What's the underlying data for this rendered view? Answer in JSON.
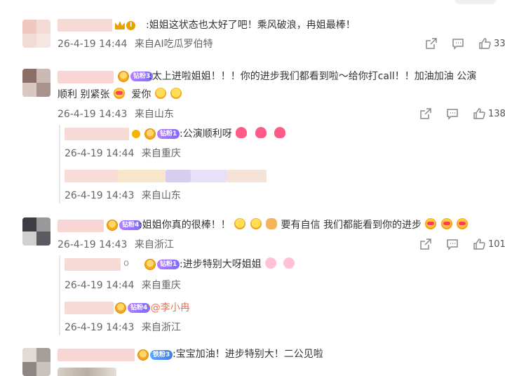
{
  "comments": [
    {
      "text": ":姐姐这状态也太好了吧！乘风破浪，冉姐最棒！",
      "date": "26-4-19 14:44",
      "source": "来自AI吃瓜罗伯特",
      "likes": "33",
      "badge": "I"
    },
    {
      "text_line1": ":太上进啦姐姐！！！你的进步我们都看到啦～给你打call！！加油加油 公演",
      "text_line2": "顺利 别紧张",
      "text_love": "爱你",
      "date": "26-4-19 14:43",
      "source": "来自山东",
      "likes": "138",
      "badge": "钻粉3",
      "replies": [
        {
          "text": ":公演顺利呀",
          "date": "26-4-19 14:44",
          "source": "来自重庆",
          "badge": "钻粉1"
        },
        {
          "text": "",
          "date": "26-4-19 14:43",
          "source": "来自山东"
        }
      ]
    },
    {
      "text_a": ":姐姐你真的很棒！！",
      "text_b": "要有自信 我们都能看到你的进步",
      "date": "26-4-19 14:43",
      "source": "来自浙江",
      "likes": "101",
      "badge": "钻粉4",
      "replies": [
        {
          "text": ":进步特别大呀姐姐",
          "date": "26-4-19 14:44",
          "source": "来自重庆",
          "badge": "钻粉1"
        },
        {
          "text": ":@李小冉",
          "date": "26-4-19 14:43",
          "source": "来自浙江",
          "badge": "钻粉4"
        }
      ]
    },
    {
      "text": ":宝宝加油！进步特别大！二公见啦",
      "badge": "铁粉3"
    }
  ],
  "icons": {
    "share": "share-icon",
    "comment": "comment-icon",
    "like": "thumbs-up-icon"
  },
  "colors": {
    "text": "#333333",
    "meta": "#666666",
    "mention": "#eb7350"
  }
}
